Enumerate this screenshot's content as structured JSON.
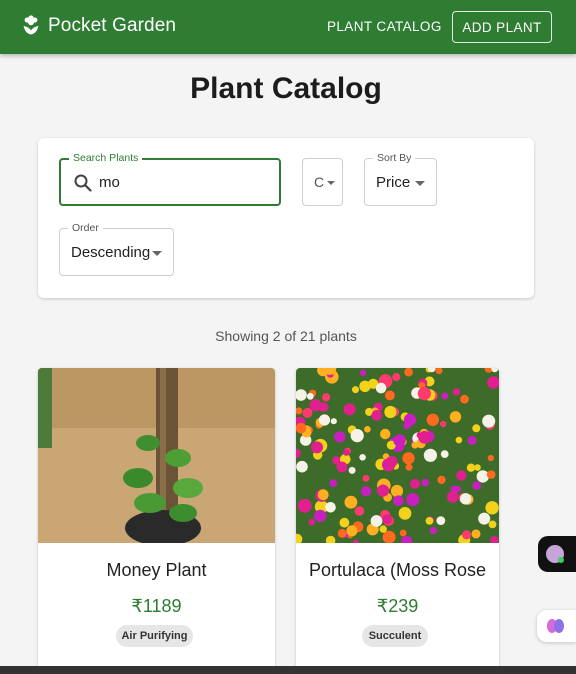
{
  "app": {
    "brand": "Pocket Garden",
    "nav_link": "PLANT CATALOG",
    "nav_button": "ADD PLANT",
    "brand_color": "#2e7d32"
  },
  "page": {
    "title": "Plant Catalog"
  },
  "filters": {
    "search_label": "Search Plants",
    "search_value": "mo",
    "category_value": "C",
    "sort_label": "Sort By",
    "sort_value": "Price",
    "order_label": "Order",
    "order_value": "Descending"
  },
  "results": {
    "summary": "Showing 2 of 21 plants"
  },
  "plants": [
    {
      "name": "Money Plant",
      "price": "₹1189",
      "tag": "Air Purifying",
      "image": "money-plant-photo"
    },
    {
      "name": "Portulaca (Moss Rose",
      "price": "₹239",
      "tag": "Succulent",
      "image": "portulaca-flowers-photo"
    }
  ],
  "icons": {
    "brand": "flower-icon",
    "search": "search-icon",
    "dropdown": "chevron-down-icon",
    "widget_a": "assistant-avatar-icon",
    "widget_b": "brain-icon"
  }
}
